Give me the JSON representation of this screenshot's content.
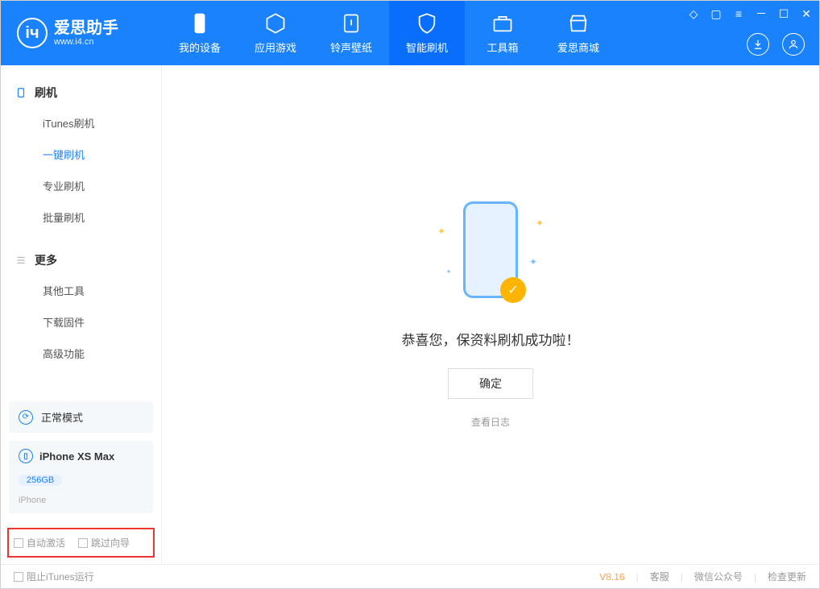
{
  "app": {
    "title": "爱思助手",
    "subtitle": "www.i4.cn"
  },
  "nav": {
    "device": "我的设备",
    "apps": "应用游戏",
    "ringtone": "铃声壁纸",
    "flash": "智能刷机",
    "toolbox": "工具箱",
    "store": "爱思商城"
  },
  "sidebar": {
    "flash_header": "刷机",
    "itunes_flash": "iTunes刷机",
    "one_key_flash": "一键刷机",
    "pro_flash": "专业刷机",
    "batch_flash": "批量刷机",
    "more_header": "更多",
    "other_tools": "其他工具",
    "download_fw": "下载固件",
    "advanced": "高级功能",
    "mode_label": "正常模式",
    "device_name": "iPhone XS Max",
    "device_storage": "256GB",
    "device_type": "iPhone",
    "auto_activate": "自动激活",
    "skip_guide": "跳过向导"
  },
  "main": {
    "success_msg": "恭喜您，保资料刷机成功啦！",
    "ok_btn": "确定",
    "log_link": "查看日志"
  },
  "footer": {
    "block_itunes": "阻止iTunes运行",
    "version": "V8.16",
    "support": "客服",
    "wechat": "微信公众号",
    "check_update": "检查更新"
  }
}
